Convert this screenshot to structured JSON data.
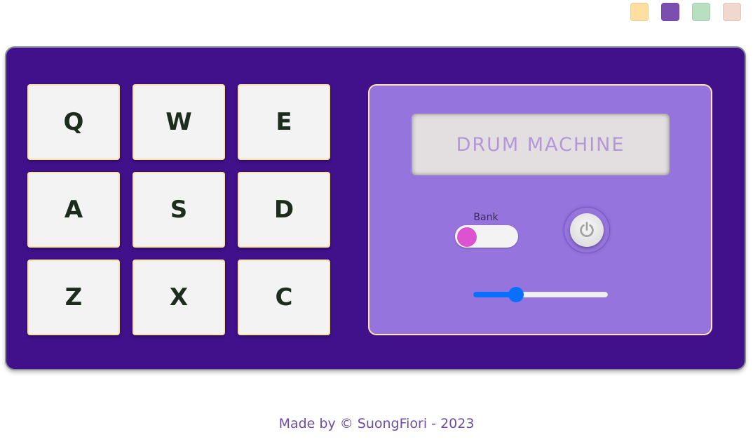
{
  "colors": {
    "machine_bg": "#40118a",
    "panel_bg": "#9575dd",
    "display_text": "#b397d6",
    "toggle_knob": "#dd52d1",
    "slider_fill": "#0b6ffd",
    "footer_text": "#6f4da1"
  },
  "swatches": [
    {
      "name": "theme-swatch-yellow",
      "color": "#ffdfa1"
    },
    {
      "name": "theme-swatch-purple",
      "color": "#7b4fb0"
    },
    {
      "name": "theme-swatch-green",
      "color": "#b8dfc0"
    },
    {
      "name": "theme-swatch-pink",
      "color": "#f0d8cf"
    }
  ],
  "pads": [
    {
      "key": "Q"
    },
    {
      "key": "W"
    },
    {
      "key": "E"
    },
    {
      "key": "A"
    },
    {
      "key": "S"
    },
    {
      "key": "D"
    },
    {
      "key": "Z"
    },
    {
      "key": "X"
    },
    {
      "key": "C"
    }
  ],
  "display": {
    "text": "DRUM MACHINE"
  },
  "bank": {
    "label": "Bank",
    "on": false
  },
  "power": {
    "icon": "power-icon"
  },
  "volume": {
    "value": 0.32
  },
  "footer": {
    "text": "Made by © SuongFiori - 2023"
  }
}
